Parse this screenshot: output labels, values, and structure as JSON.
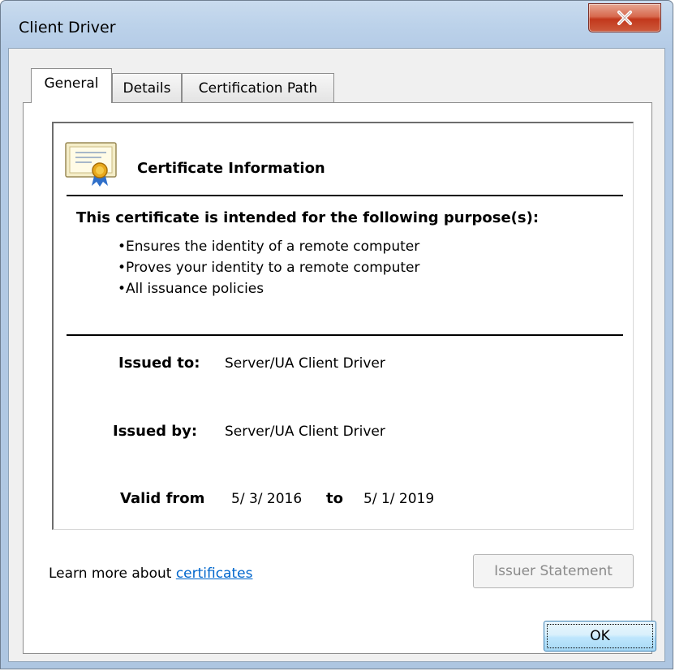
{
  "window": {
    "title": "Client Driver"
  },
  "tabs": [
    {
      "label": "General",
      "active": true
    },
    {
      "label": "Details",
      "active": false
    },
    {
      "label": "Certification Path",
      "active": false
    }
  ],
  "certificate": {
    "section_title": "Certificate Information",
    "purpose_heading": "This certificate is intended for the following purpose(s):",
    "purposes": [
      "Ensures the identity of a remote computer",
      "Proves your identity to a remote computer",
      "All issuance policies"
    ],
    "issued_to_label": "Issued to:",
    "issued_to_value": "Server/UA Client Driver",
    "issued_by_label": "Issued by:",
    "issued_by_value": "Server/UA Client Driver",
    "valid_from_label": "Valid from",
    "valid_from_value": "5/ 3/ 2016",
    "valid_to_label": "to",
    "valid_to_value": "5/ 1/ 2019"
  },
  "footer": {
    "learn_more_prefix": "Learn more about ",
    "learn_more_link": "certificates",
    "issuer_statement_label": "Issuer Statement",
    "issuer_statement_enabled": false,
    "ok_label": "OK"
  },
  "icons": {
    "close": "close-icon",
    "certificate": "certificate-icon"
  },
  "colors": {
    "link": "#0066cc",
    "close_button": "#c2381c",
    "title_bar": "#bcd2ea"
  }
}
